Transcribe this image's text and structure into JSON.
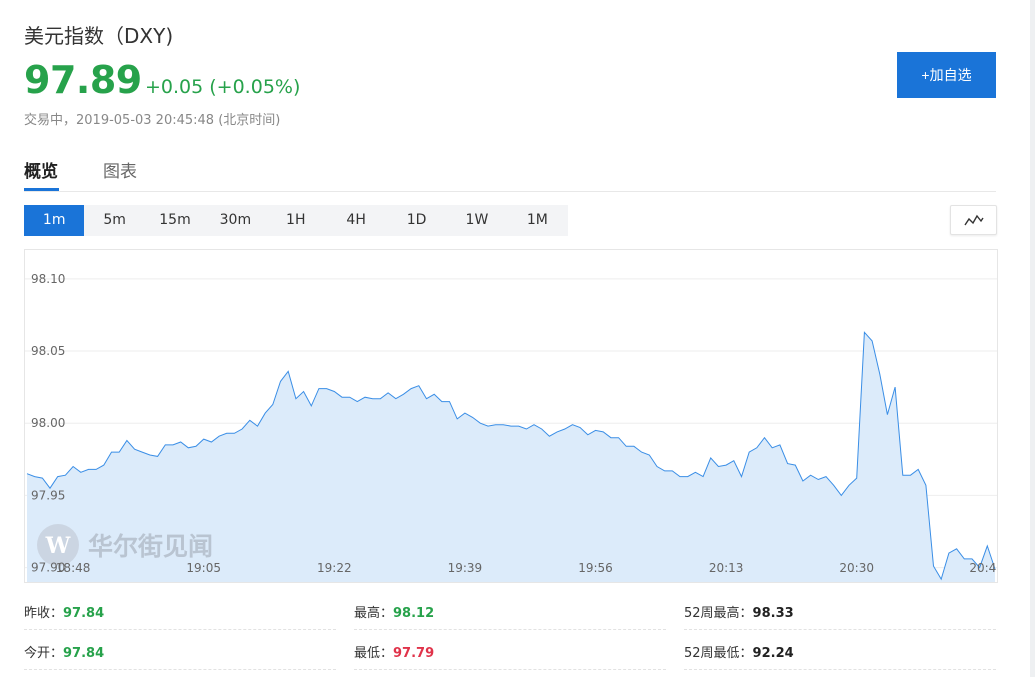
{
  "header": {
    "title": "美元指数（DXY)",
    "price": "97.89",
    "change": "+0.05 (+0.05%)",
    "status": "交易中，2019-05-03 20:45:48 (北京时间)",
    "add_button": "+加自选"
  },
  "tabs": [
    {
      "label": "概览",
      "active": true
    },
    {
      "label": "图表",
      "active": false
    }
  ],
  "intervals": [
    "1m",
    "5m",
    "15m",
    "30m",
    "1H",
    "4H",
    "1D",
    "1W",
    "1M"
  ],
  "active_interval": "1m",
  "chart_type_icon": "line-chart-icon",
  "watermark": {
    "text": "华尔街见闻",
    "icon": "wallstreetcn-logo-icon"
  },
  "colors": {
    "accent": "#1a74d8",
    "up": "#27a24b",
    "down": "#e0334a",
    "line": "#3a8ee6",
    "fill": "#dcebfa"
  },
  "chart_data": {
    "type": "area",
    "title": "",
    "xlabel": "",
    "ylabel": "",
    "ylim": [
      97.89,
      98.12
    ],
    "yticks": [
      "98.10",
      "98.05",
      "98.00",
      "97.95",
      "97.90"
    ],
    "ytick_values": [
      98.1,
      98.05,
      98.0,
      97.95,
      97.9
    ],
    "xticks": [
      "18:48",
      "19:05",
      "19:22",
      "19:39",
      "19:56",
      "20:13",
      "20:30",
      "20:4"
    ],
    "xtick_index": [
      6,
      23,
      40,
      57,
      74,
      91,
      108,
      125
    ],
    "grid": true,
    "series": [
      {
        "values": [
          97.965,
          97.963,
          97.962,
          97.955,
          97.963,
          97.964,
          97.97,
          97.966,
          97.968,
          97.968,
          97.971,
          97.98,
          97.98,
          97.988,
          97.982,
          97.98,
          97.978,
          97.977,
          97.985,
          97.985,
          97.987,
          97.983,
          97.984,
          97.989,
          97.987,
          97.991,
          97.993,
          97.993,
          97.996,
          98.002,
          97.998,
          98.007,
          98.013,
          98.029,
          98.036,
          98.017,
          98.022,
          98.012,
          98.024,
          98.024,
          98.022,
          98.018,
          98.018,
          98.015,
          98.018,
          98.017,
          98.017,
          98.021,
          98.017,
          98.02,
          98.024,
          98.026,
          98.017,
          98.02,
          98.015,
          98.015,
          98.003,
          98.007,
          98.004,
          98.0,
          97.998,
          97.999,
          97.999,
          97.998,
          97.998,
          97.996,
          97.999,
          97.996,
          97.991,
          97.994,
          97.996,
          97.999,
          97.997,
          97.992,
          97.995,
          97.994,
          97.99,
          97.99,
          97.984,
          97.984,
          97.98,
          97.978,
          97.97,
          97.967,
          97.967,
          97.963,
          97.963,
          97.966,
          97.963,
          97.976,
          97.97,
          97.971,
          97.974,
          97.963,
          97.98,
          97.983,
          97.99,
          97.983,
          97.985,
          97.972,
          97.971,
          97.96,
          97.964,
          97.961,
          97.963,
          97.957,
          97.95,
          97.957,
          97.962,
          98.063,
          98.057,
          98.034,
          98.006,
          98.025,
          97.964,
          97.964,
          97.968,
          97.957,
          97.901,
          97.892,
          97.91,
          97.913,
          97.906,
          97.906,
          97.9,
          97.915,
          97.899
        ]
      }
    ]
  },
  "stats": [
    {
      "label": "昨收：",
      "value": "97.84",
      "color": "green"
    },
    {
      "label": "最高：",
      "value": "98.12",
      "color": "green"
    },
    {
      "label": "52周最高：",
      "value": "98.33",
      "color": "black"
    },
    {
      "label": "今开：",
      "value": "97.84",
      "color": "green"
    },
    {
      "label": "最低：",
      "value": "97.79",
      "color": "red"
    },
    {
      "label": "52周最低：",
      "value": "92.24",
      "color": "black"
    }
  ]
}
